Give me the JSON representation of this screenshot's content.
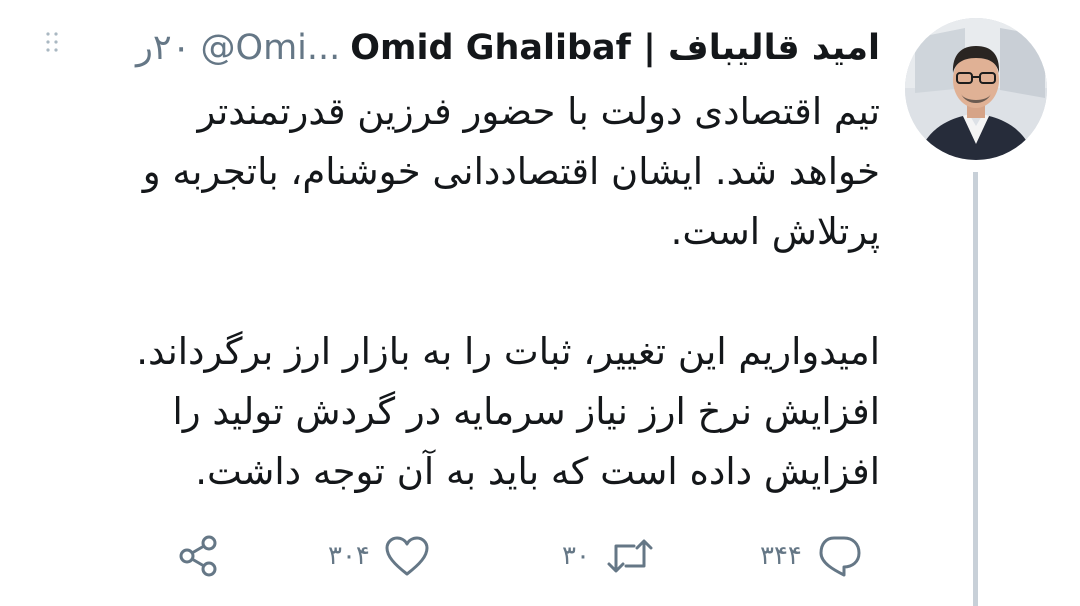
{
  "tweet": {
    "author_name": "امید قالیباف | Omid Ghalibaf",
    "handle": "@Omi...",
    "time": "۲۰ر",
    "paragraphs": [
      "تیم اقتصادی دولت با حضور فرزین قدرتمندتر\nخواهد شد. ایشان اقتصاددانی خوشنام، باتجربه و\nپرتلاش است.",
      "امیدواریم این تغییر، ثبات را به بازار ارز برگرداند.\nافزایش نرخ ارز نیاز سرمایه در گردش تولید را\nافزایش داده است که باید به آن توجه داشت."
    ]
  },
  "actions": {
    "reply_count": "۳۴۴",
    "retweet_count": "۳۰",
    "like_count": "۳۰۴"
  },
  "icons": {
    "reply": "reply-icon",
    "retweet": "retweet-icon",
    "like": "heart-icon",
    "share": "share-icon",
    "menu": "chevron-down-icon"
  },
  "colors": {
    "text": "#14171a",
    "muted": "#657786",
    "thread_line": "#c8d0d8"
  }
}
